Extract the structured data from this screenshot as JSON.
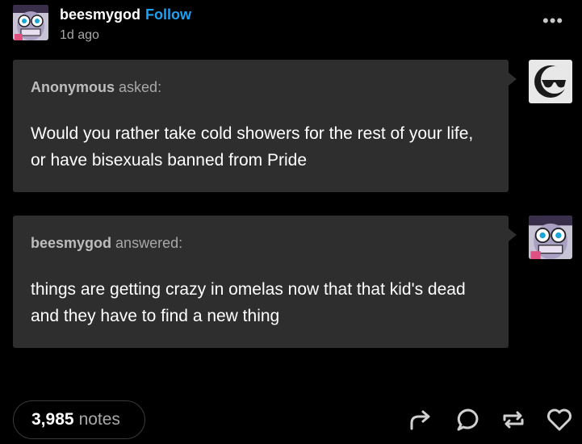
{
  "post": {
    "username": "beesmygod",
    "follow_label": "Follow",
    "timestamp": "1d ago",
    "more_label": "•••"
  },
  "ask": {
    "asker": "Anonymous",
    "verb": "asked:",
    "question": "Would you rather take cold showers for the rest of your life, or have bisexuals banned from Pride"
  },
  "answer": {
    "answerer": "beesmygod",
    "verb": "answered:",
    "text": "things are getting crazy in omelas now that that kid's dead and they have to find a new thing"
  },
  "footer": {
    "notes_count": "3,985",
    "notes_label": "notes",
    "icons": [
      "share-icon",
      "reply-icon",
      "reblog-icon",
      "like-icon"
    ]
  },
  "colors": {
    "background": "#000000",
    "bubble": "#2e2e2e",
    "follow": "#1da1f2",
    "muted": "#a8a8a8"
  }
}
